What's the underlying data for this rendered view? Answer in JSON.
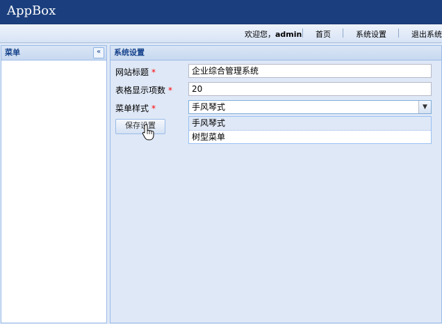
{
  "app": {
    "title": "AppBox"
  },
  "toolbar": {
    "welcome_prefix": "欢迎您，",
    "username": "admin",
    "home": "首页",
    "settings": "系统设置",
    "logout": "退出系统"
  },
  "sidebar": {
    "title": "菜单",
    "collapse_icon": "«"
  },
  "main": {
    "title": "系统设置",
    "required_mark": "*",
    "form": {
      "site_title": {
        "label": "网站标题",
        "value": "企业综合管理系统"
      },
      "page_size": {
        "label": "表格显示项数",
        "value": "20"
      },
      "menu_style": {
        "label": "菜单样式",
        "value": "手风琴式",
        "options": [
          "手风琴式",
          "树型菜单"
        ],
        "trigger_icon": "▼"
      }
    },
    "save_button": "保存设置"
  }
}
